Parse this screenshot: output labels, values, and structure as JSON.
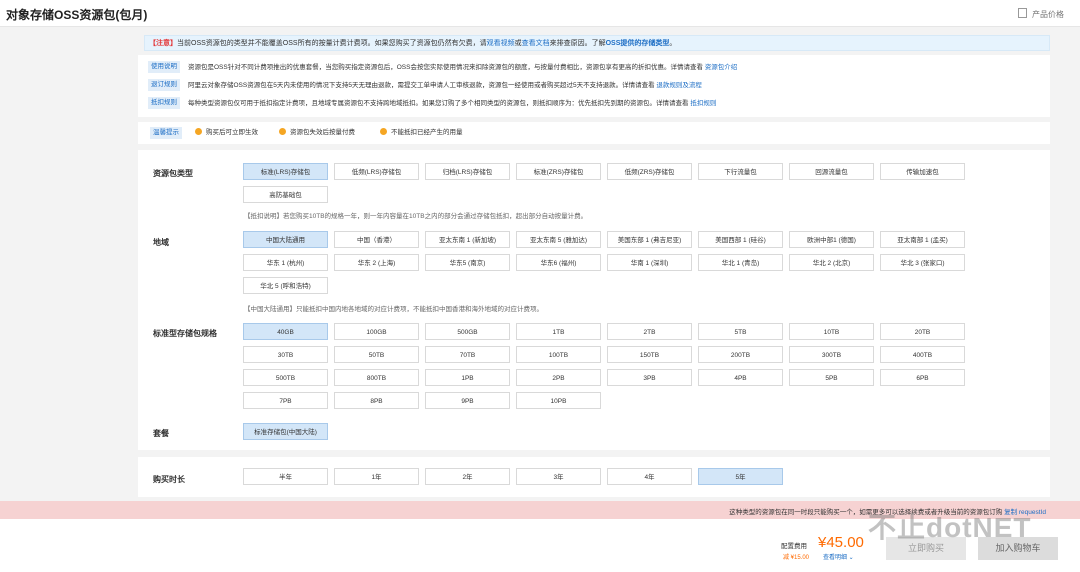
{
  "page": {
    "title": "对象存储OSS资源包(包月)",
    "price_link": "产品价格"
  },
  "notice": {
    "tag": "【注意】",
    "text1": "当前OSS资源包的类型并不能覆盖OSS所有的按量计费计费项。如果您购买了资源包仍然有欠费，请",
    "link1": "观看视频",
    "or": "或",
    "link2": "查看文档",
    "text2": "来排查原因。了解",
    "link3": "OSS提供的存储类型",
    "end": "。"
  },
  "info": [
    {
      "label": "使用说明",
      "text": "资源包是OSS针对不同计费项推出的优惠套餐，当您购买指定资源包后，OSS会按您实际使用情况来扣除资源包的额度，与按量付费相比，资源包享有更高的折扣优惠。详情请查看 ",
      "link": "资源包介绍"
    },
    {
      "label": "退订规则",
      "text": "阿里云对象存储OSS资源包在5天内未使用的情况下支持5天无理由退款，需提交工单申请人工审核退款，资源包一经使用或者购买超过5天不支持退款。详情请查看 ",
      "link": "退款规则及流程"
    },
    {
      "label": "抵扣规则",
      "text": "每种类型资源包仅可用于抵扣指定计费项，且地域专属资源包不支持跨地域抵扣。如果您订购了多个相同类型的资源包，则抵扣顺序为：优先抵扣先到期的资源包。详情请查看 ",
      "link": "抵扣规则"
    }
  ],
  "tips": {
    "label": "温馨提示",
    "items": [
      "购买后可立即生效",
      "资源包失效后按量付费",
      "不能抵扣已经产生的用量"
    ]
  },
  "package_type": {
    "label": "资源包类型",
    "options": [
      "标准(LRS)存储包",
      "低频(LRS)存储包",
      "归档(LRS)存储包",
      "标准(ZRS)存储包",
      "低频(ZRS)存储包",
      "下行流量包",
      "回源流量包",
      "传输加速包",
      "高防基础包"
    ],
    "selected": 0,
    "note": "【抵扣说明】若您购买10TB的规格一年，则一年内容量在10TB之内的部分会通过存储包抵扣，超出部分自动按量计费。"
  },
  "region": {
    "label": "地域",
    "options": [
      "中国大陆通用",
      "中国（香港）",
      "亚太东南 1 (新加坡)",
      "亚太东南 5 (雅加达)",
      "美国东部 1 (弗吉尼亚)",
      "美国西部 1 (硅谷)",
      "欧洲中部1 (德国)",
      "亚太南部 1 (孟买)",
      "华东 1 (杭州)",
      "华东 2 (上海)",
      "华东5 (南京)",
      "华东6 (福州)",
      "华南 1 (深圳)",
      "华北 1 (青岛)",
      "华北 2 (北京)",
      "华北 3 (张家口)",
      "华北 5 (呼和浩特)"
    ],
    "selected": 0,
    "note": "【中国大陆通用】只能抵扣中国内地各地域的对应计费项，不能抵扣中国香港和海外地域的对应计费项。"
  },
  "size": {
    "label": "标准型存储包规格",
    "options": [
      "40GB",
      "100GB",
      "500GB",
      "1TB",
      "2TB",
      "5TB",
      "10TB",
      "20TB",
      "30TB",
      "50TB",
      "70TB",
      "100TB",
      "150TB",
      "200TB",
      "300TB",
      "400TB",
      "500TB",
      "800TB",
      "1PB",
      "2PB",
      "3PB",
      "4PB",
      "5PB",
      "6PB",
      "7PB",
      "8PB",
      "9PB",
      "10PB"
    ],
    "selected": 0
  },
  "plan": {
    "label": "套餐",
    "options": [
      "标准存储包(中国大陆)"
    ],
    "selected": 0
  },
  "duration": {
    "label": "购买时长",
    "options": [
      "半年",
      "1年",
      "2年",
      "3年",
      "4年",
      "5年"
    ],
    "selected": 5
  },
  "warning": {
    "text": "这种类型的资源包在同一时段只能购买一个，如需更多可以选择续费或者升级当前的资源包订购",
    "link": "复制 requestId"
  },
  "footer": {
    "fee_label": "配置费用",
    "fee": "¥45.00",
    "discount": "减 ¥15.00",
    "detail": "查看明细 ⌄",
    "buy": "立即购买",
    "cart": "加入购物车"
  },
  "watermark": "不止dotNET",
  "colors": {
    "accent": "#1d6ec5",
    "selected_bg": "#d3e6f8",
    "price": "#ff6a00",
    "warn_bg": "#f6d2d2"
  }
}
